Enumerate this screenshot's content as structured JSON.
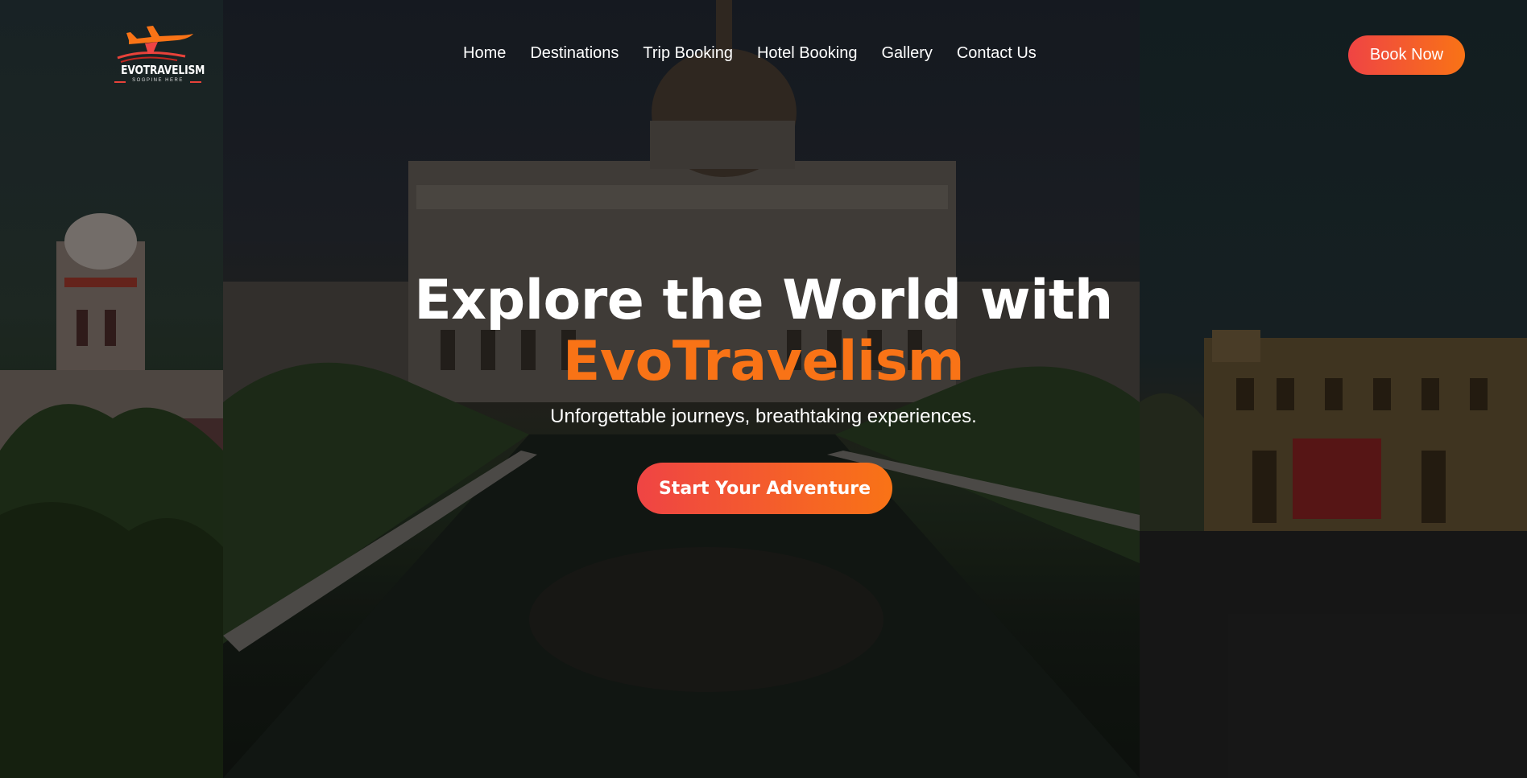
{
  "brand": {
    "name": "EVOTRAVELISM",
    "tagline": "SOGPINE HERE"
  },
  "nav": {
    "items": [
      {
        "label": "Home"
      },
      {
        "label": "Destinations"
      },
      {
        "label": "Trip Booking"
      },
      {
        "label": "Hotel Booking"
      },
      {
        "label": "Gallery"
      },
      {
        "label": "Contact Us"
      }
    ],
    "book_now": "Book Now"
  },
  "hero": {
    "headline_line1": "Explore the World with",
    "headline_line2": "EvoTravelism",
    "subtitle": "Unforgettable journeys, breathtaking experiences.",
    "cta": "Start Your Adventure"
  },
  "colors": {
    "accent_start": "#ef4444",
    "accent_end": "#f97316",
    "text": "#ffffff"
  },
  "icons": {
    "logo": "airplane-icon"
  }
}
